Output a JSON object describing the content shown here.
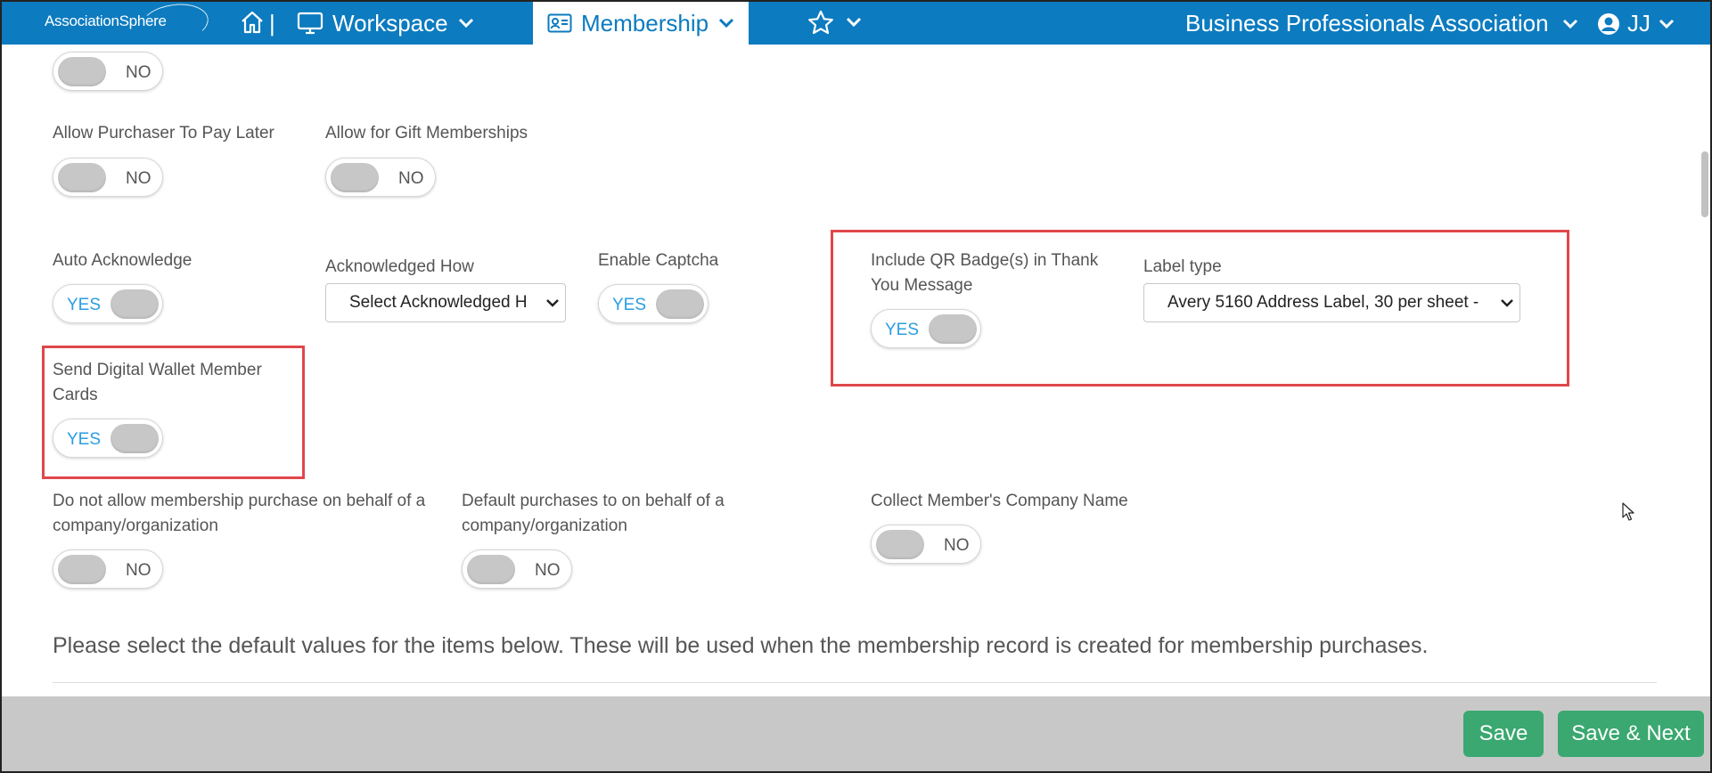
{
  "nav": {
    "logo": "AssociationSphere",
    "separator": "|",
    "workspace": "Workspace",
    "membership": "Membership",
    "organization": "Business Professionals Association",
    "user_initials": "JJ"
  },
  "form": {
    "top_toggle": {
      "value": "NO"
    },
    "pay_later": {
      "label": "Allow Purchaser To Pay Later",
      "value": "NO"
    },
    "gift": {
      "label": "Allow for Gift Memberships",
      "value": "NO"
    },
    "auto_ack": {
      "label": "Auto Acknowledge",
      "value": "YES"
    },
    "ack_how": {
      "label": "Acknowledged How",
      "value": "Select Acknowledged H"
    },
    "captcha": {
      "label": "Enable Captcha",
      "value": "YES"
    },
    "qr_badge": {
      "label_line1": "Include QR Badge(s) in Thank",
      "label_line2": "You Message",
      "value": "YES"
    },
    "label_type": {
      "label": "Label type",
      "value": "Avery 5160 Address Label, 30 per sheet -"
    },
    "digital_wallet": {
      "label_line1": "Send Digital Wallet Member",
      "label_line2": "Cards",
      "value": "YES"
    },
    "no_behalf": {
      "label_line1": "Do not allow membership purchase on behalf of a",
      "label_line2": "company/organization",
      "value": "NO"
    },
    "default_behalf": {
      "label_line1": "Default purchases to on behalf of a",
      "label_line2": "company/organization",
      "value": "NO"
    },
    "company_name": {
      "label": "Collect Member's Company Name",
      "value": "NO"
    },
    "notice": "Please select the default values for the items below. These will be used when the membership record is created for membership purchases."
  },
  "footer": {
    "save": "Save",
    "save_next": "Save & Next"
  },
  "colors": {
    "nav": "#0c7bbf",
    "toggle_yes": "#2a9de0",
    "highlight": "#e0474c",
    "button": "#3aa870",
    "footer": "#c8c8c8"
  }
}
